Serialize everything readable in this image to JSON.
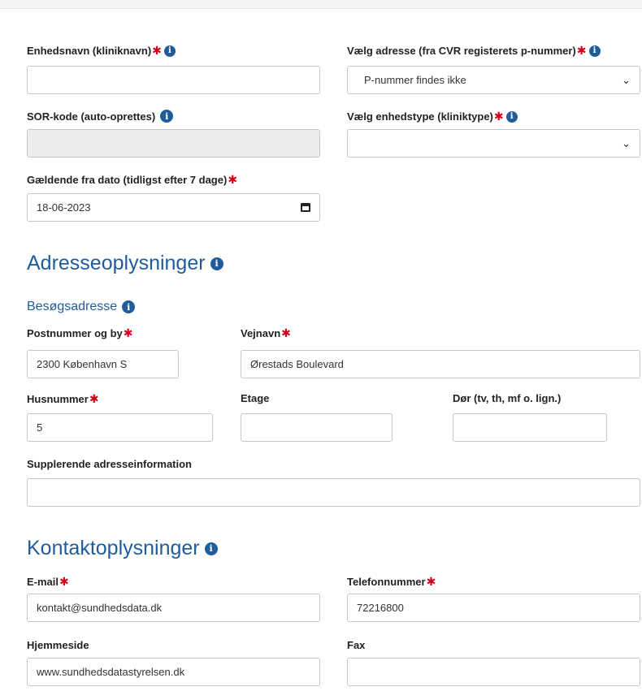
{
  "unit": {
    "name_label": "Enhedsnavn (kliniknavn)",
    "name_value": "",
    "address_label": "Vælg adresse (fra CVR registerets p-nummer)",
    "address_value": "P-nummer findes ikke",
    "sor_label": "SOR-kode (auto-oprettes)",
    "sor_value": "",
    "type_label": "Vælg enhedstype (kliniktype)",
    "type_value": "",
    "date_label": "Gældende fra dato (tidligst efter 7 dage)",
    "date_value": "18-06-2023"
  },
  "address": {
    "heading": "Adresseoplysninger",
    "subheading": "Besøgsadresse",
    "postal_label": "Postnummer og by",
    "postal_value": "2300 København S",
    "street_label": "Vejnavn",
    "street_value": "Ørestads Boulevard",
    "house_label": "Husnummer",
    "house_value": "5",
    "floor_label": "Etage",
    "floor_value": "",
    "door_label": "Dør (tv, th, mf o. lign.)",
    "door_value": "",
    "extra_label": "Supplerende adresseinformation",
    "extra_value": ""
  },
  "contact": {
    "heading": "Kontaktoplysninger",
    "email_label": "E-mail",
    "email_value": "kontakt@sundhedsdata.dk",
    "phone_label": "Telefonnummer",
    "phone_value": "72216800",
    "web_label": "Hjemmeside",
    "web_value": "www.sundhedsdatastyrelsen.dk",
    "fax_label": "Fax",
    "fax_value": ""
  },
  "glyphs": {
    "required": "✱",
    "info": "i",
    "chevron": "⌄"
  },
  "colors": {
    "accent": "#1f5c99",
    "required": "#d0021b",
    "disabled_bg": "#ececec"
  }
}
